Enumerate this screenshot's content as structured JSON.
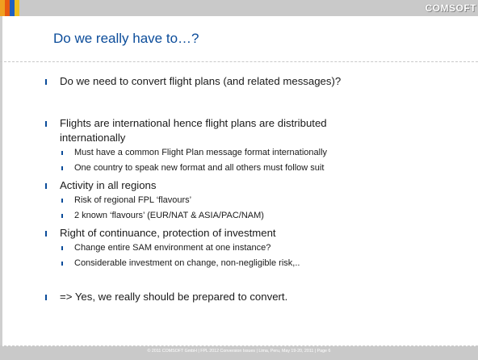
{
  "header": {
    "logo_text": "COMSOFT",
    "color_blocks": [
      "#f0a020",
      "#e85a10",
      "#2060c0",
      "#f0c020"
    ]
  },
  "title": "Do we really have to…?",
  "bullets": [
    {
      "text": "Do we need to convert flight plans (and related messages)?",
      "sub": []
    },
    {
      "text": "Flights are international hence flight plans are distributed",
      "text2": "internationally",
      "sub": [
        "Must have a common Flight Plan message format internationally",
        "One country to speak new format and all others must follow suit"
      ]
    },
    {
      "text": "Activity in all regions",
      "sub": [
        "Risk of regional FPL ‘flavours’",
        "2 known ‘flavours’ (EUR/NAT & ASIA/PAC/NAM)"
      ]
    },
    {
      "text": "Right of continuance, protection of investment",
      "sub": [
        "Change entire SAM environment at one instance?",
        "Considerable investment on change, non-negligible risk,.."
      ]
    },
    {
      "text": "=> Yes, we really should be prepared to convert.",
      "sub": []
    }
  ],
  "footer": "© 2011 COMSOFT GmbH   |   FPL 2012 Conversion Issues   |   Lima, Peru, May 19-20, 2011   |   Page 6",
  "colors": {
    "accent": "#0b4c9a",
    "bar": "#c9c9c9"
  }
}
